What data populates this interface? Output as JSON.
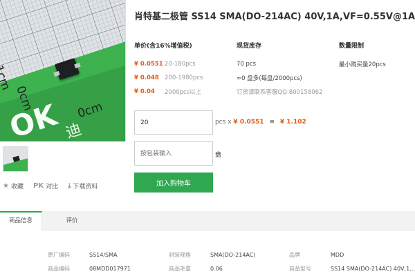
{
  "product": {
    "title": "肖特基二极管 SS14 SMA(DO-214AC) 40V,1A,VF=0.55V@1A"
  },
  "image_labels": {
    "ruler_cm_1": "1cm",
    "ruler_cm_0": "0cm",
    "ruler_cm_0b": "0cm"
  },
  "price_section": {
    "heading": "单价(含16%增值税)",
    "tiers": [
      {
        "price": "¥ 0.0551",
        "range": "20-180pcs"
      },
      {
        "price": "¥ 0.048",
        "range": "200-1980pcs"
      },
      {
        "price": "¥ 0.04",
        "range": "2000pcs以上"
      }
    ]
  },
  "stock_section": {
    "heading": "现货库存",
    "qty": "70 pcs",
    "pack": "≈0 盘多(每盘/2000pcs)",
    "contact": "订货请联系客服QQ:800158062"
  },
  "limit_section": {
    "heading": "数量限制",
    "min_buy": "最小购买量20pcs"
  },
  "order": {
    "qty_value": "20",
    "unit_x": "pcs x",
    "unit_price": "¥ 0.0551",
    "equals": "=",
    "total": "¥ 1.102",
    "pack_placeholder": "按包装输入",
    "pack_unit": "盘",
    "cart_label": "加入购物车"
  },
  "actions": {
    "fav": "收藏",
    "compare_prefix": "PK",
    "compare": "对比",
    "download": "下载资料"
  },
  "tabs": [
    "商品信息",
    "评价"
  ],
  "specs": [
    {
      "key": "原厂编码",
      "value": "SS14/SMA"
    },
    {
      "key": "封装规格",
      "value": "SMA(DO-214AC)"
    },
    {
      "key": "品牌",
      "value": "MDD"
    },
    {
      "key": "商品编码",
      "value": "08MDD017971"
    },
    {
      "key": "商品毛重",
      "value": "0.06"
    },
    {
      "key": "商品型号",
      "value": "SS14 SMA(DO-214AC) 40V,1..."
    }
  ],
  "colors": {
    "accent_green": "#2fa84f",
    "price_orange": "#e8590c"
  }
}
